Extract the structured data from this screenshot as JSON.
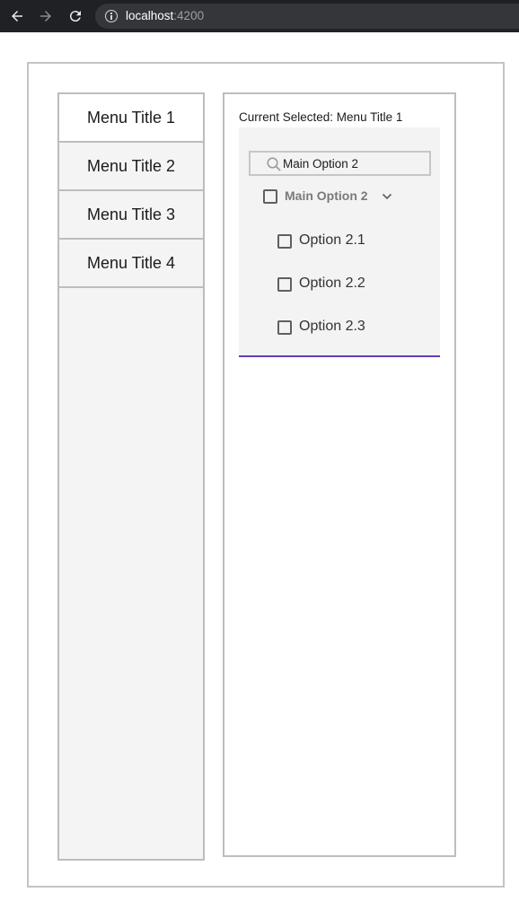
{
  "browser": {
    "url_host": "localhost",
    "url_port": ":4200",
    "icons": [
      "back-arrow-icon",
      "forward-arrow-icon",
      "reload-icon",
      "info-icon"
    ]
  },
  "sidebar": {
    "items": [
      {
        "label": "Menu Title 1",
        "active": true
      },
      {
        "label": "Menu Title 2",
        "active": false
      },
      {
        "label": "Menu Title 3",
        "active": false
      },
      {
        "label": "Menu Title 4",
        "active": false
      }
    ]
  },
  "content": {
    "current_selected": "Current Selected: Menu Title 1",
    "search": {
      "value": "Main Option 2"
    },
    "group": {
      "label": "Main Option 2",
      "checked": false,
      "expanded": true,
      "options": [
        {
          "label": "Option 2.1",
          "checked": false
        },
        {
          "label": "Option 2.2",
          "checked": false
        },
        {
          "label": "Option 2.3",
          "checked": false
        }
      ]
    }
  },
  "colors": {
    "accent_underline": "#673ab7",
    "browser_bar": "#202124",
    "sidebar_bg": "#f4f4f4"
  }
}
